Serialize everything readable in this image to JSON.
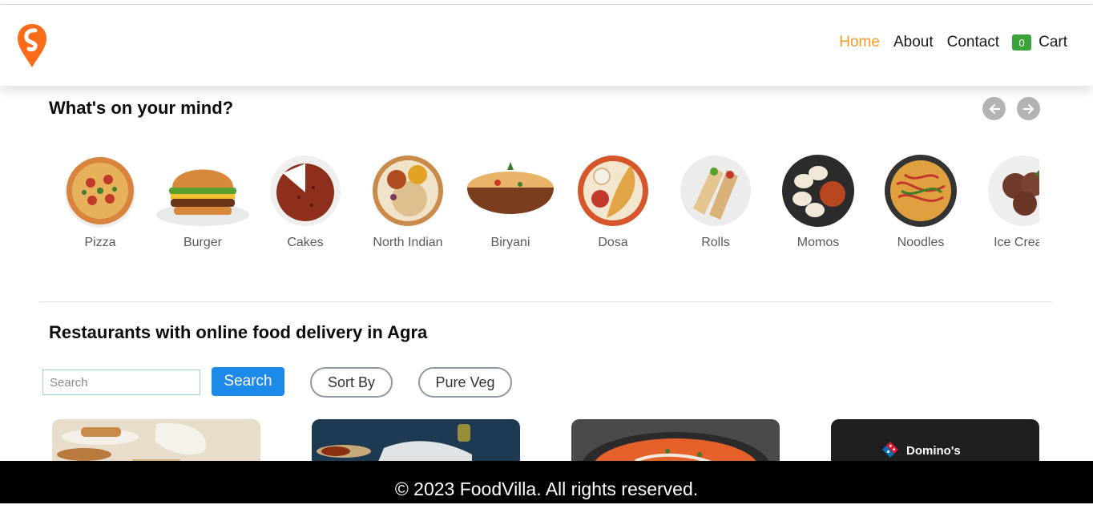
{
  "header": {
    "logo": "swiggy-logo-icon",
    "brand_color": "#fc6b1a",
    "nav": [
      "Home",
      "About",
      "Contact"
    ],
    "active_color": "#f59a23",
    "cart": {
      "count": "0",
      "label": "Cart",
      "badge_color": "#3aa33a"
    }
  },
  "mind": {
    "title": "What's on your mind?",
    "prev_icon": "arrow-left-icon",
    "next_icon": "arrow-right-icon",
    "items": [
      "Pizza",
      "Burger",
      "Cakes",
      "North Indian",
      "Biryani",
      "Dosa",
      "Rolls",
      "Momos",
      "Noodles",
      "Ice Cream"
    ]
  },
  "restaurants": {
    "title": "Restaurants with online food delivery in Agra",
    "search_placeholder": "Search",
    "search_value": "",
    "search_button": "Search",
    "sort_button": "Sort By",
    "veg_button": "Pure Veg",
    "cards": [
      {
        "image": "bakery-snacks-image",
        "brand": ""
      },
      {
        "image": "indian-dish-image",
        "brand": ""
      },
      {
        "image": "soup-bowl-image",
        "brand": ""
      },
      {
        "image": "dominos-logo-image",
        "brand": "Domino's"
      }
    ]
  },
  "footer": {
    "text": "© 2023 FoodVilla. All rights reserved."
  },
  "colors": {
    "search_button": "#1d89e8",
    "footer_bg": "#000000",
    "label_grey": "#595959"
  }
}
